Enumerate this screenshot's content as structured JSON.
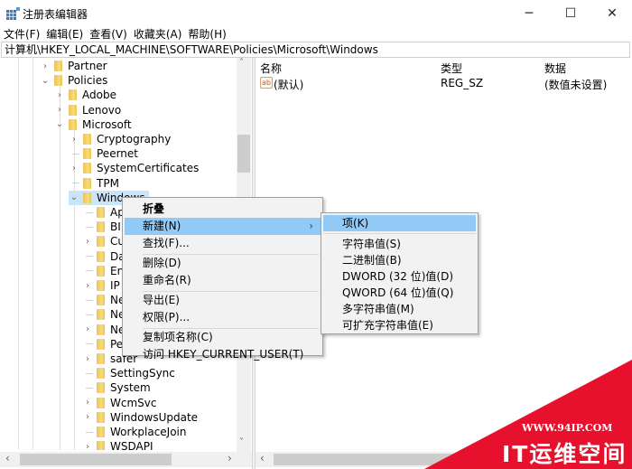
{
  "window": {
    "title": "注册表编辑器",
    "minimize_glyph": "─",
    "maximize_glyph": "☐",
    "close_glyph": "✕"
  },
  "menu": [
    "文件(F)",
    "编辑(E)",
    "查看(V)",
    "收藏夹(A)",
    "帮助(H)"
  ],
  "address": "计算机\\HKEY_LOCAL_MACHINE\\SOFTWARE\\Policies\\Microsoft\\Windows",
  "tree": [
    {
      "label": "Partner",
      "level": 0,
      "expander": "collapsed"
    },
    {
      "label": "Policies",
      "level": 0,
      "expander": "expanded"
    },
    {
      "label": "Adobe",
      "level": 1,
      "expander": "collapsed"
    },
    {
      "label": "Lenovo",
      "level": 1,
      "expander": "collapsed"
    },
    {
      "label": "Microsoft",
      "level": 1,
      "expander": "expanded"
    },
    {
      "label": "Cryptography",
      "level": 2,
      "expander": "collapsed"
    },
    {
      "label": "Peernet",
      "level": 2,
      "expander": "none"
    },
    {
      "label": "SystemCertificates",
      "level": 2,
      "expander": "collapsed"
    },
    {
      "label": "TPM",
      "level": 2,
      "expander": "none"
    },
    {
      "label": "Windows",
      "level": 2,
      "expander": "expanded",
      "selected": true
    },
    {
      "label": "Ap",
      "level": 3,
      "expander": "none"
    },
    {
      "label": "BI",
      "level": 3,
      "expander": "none"
    },
    {
      "label": "Cu",
      "level": 3,
      "expander": "collapsed"
    },
    {
      "label": "Da",
      "level": 3,
      "expander": "none"
    },
    {
      "label": "En",
      "level": 3,
      "expander": "none"
    },
    {
      "label": "IP",
      "level": 3,
      "expander": "collapsed"
    },
    {
      "label": "Ne",
      "level": 3,
      "expander": "none"
    },
    {
      "label": "Ne",
      "level": 3,
      "expander": "none"
    },
    {
      "label": "Ne",
      "level": 3,
      "expander": "collapsed"
    },
    {
      "label": "Pe",
      "level": 3,
      "expander": "none"
    },
    {
      "label": "safer",
      "level": 3,
      "expander": "collapsed"
    },
    {
      "label": "SettingSync",
      "level": 3,
      "expander": "none"
    },
    {
      "label": "System",
      "level": 3,
      "expander": "none"
    },
    {
      "label": "WcmSvc",
      "level": 3,
      "expander": "collapsed"
    },
    {
      "label": "WindowsUpdate",
      "level": 3,
      "expander": "collapsed"
    },
    {
      "label": "WorkplaceJoin",
      "level": 3,
      "expander": "none"
    },
    {
      "label": "WSDAPI",
      "level": 3,
      "expander": "collapsed"
    }
  ],
  "list": {
    "columns": [
      "名称",
      "类型",
      "数据"
    ],
    "rows": [
      {
        "icon": "ab",
        "name": "(默认)",
        "type": "REG_SZ",
        "data": "(数值未设置)"
      }
    ]
  },
  "context_menu": {
    "items": [
      {
        "label": "折叠",
        "bold": true
      },
      {
        "label": "新建(N)",
        "submenu": true,
        "highlighted": true
      },
      {
        "label": "查找(F)..."
      },
      {
        "sep": true
      },
      {
        "label": "删除(D)"
      },
      {
        "label": "重命名(R)"
      },
      {
        "sep": true
      },
      {
        "label": "导出(E)"
      },
      {
        "label": "权限(P)..."
      },
      {
        "sep": true
      },
      {
        "label": "复制项名称(C)"
      },
      {
        "label": "访问 HKEY_CURRENT_USER(T)"
      }
    ],
    "arrow": "›"
  },
  "submenu": {
    "items": [
      {
        "label": "项(K)",
        "highlighted": true
      },
      {
        "sep": true
      },
      {
        "label": "字符串值(S)"
      },
      {
        "label": "二进制值(B)"
      },
      {
        "label": "DWORD (32 位)值(D)"
      },
      {
        "label": "QWORD (64 位)值(Q)"
      },
      {
        "label": "多字符串值(M)"
      },
      {
        "label": "可扩充字符串值(E)"
      }
    ]
  },
  "scroll": {
    "up": "˄",
    "down": "˅",
    "left": "‹",
    "right": "›"
  },
  "watermark": {
    "url": "WWW.94IP.COM",
    "name": "IT运维空间",
    "color": "#e8112d"
  }
}
